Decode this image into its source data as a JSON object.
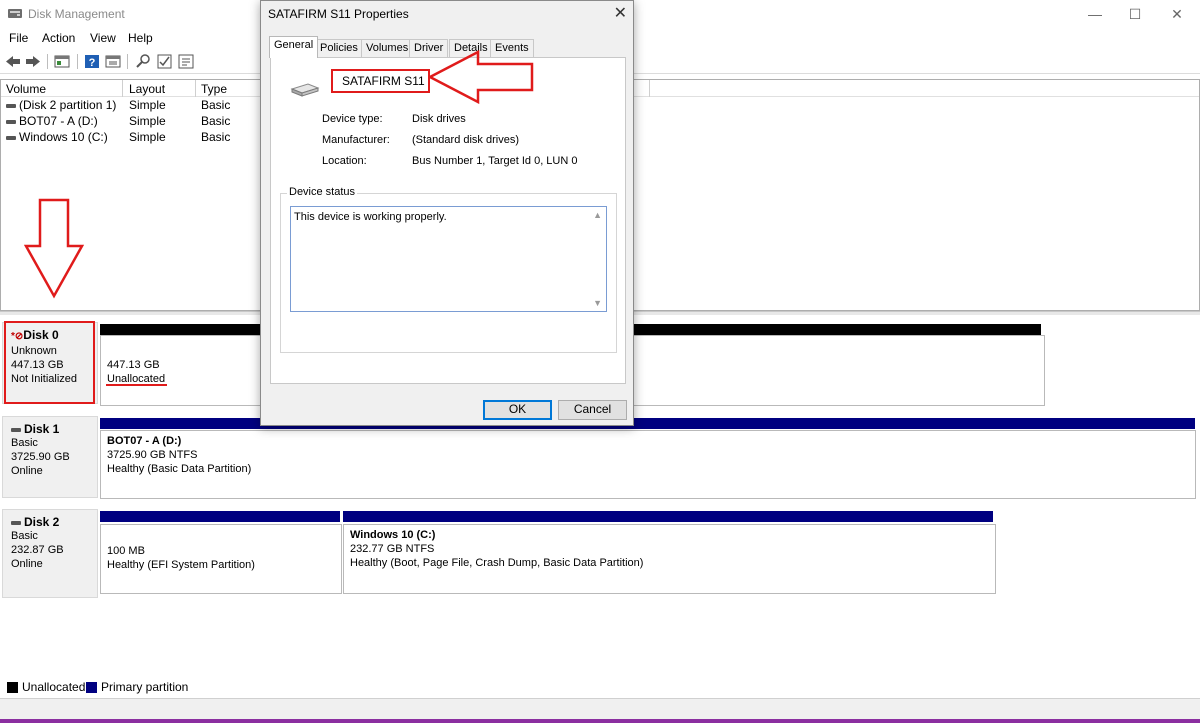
{
  "window": {
    "title": "Disk Management"
  },
  "menu": [
    "File",
    "Action",
    "View",
    "Help"
  ],
  "toolbar_icons": [
    "back-arrow-icon",
    "forward-arrow-icon",
    "console-tree-icon",
    "help-icon",
    "properties-sheet-icon",
    "connect-icon",
    "check-icon",
    "settings-list-icon"
  ],
  "volume_list": {
    "headers": [
      "Volume",
      "Layout",
      "Type"
    ],
    "rows": [
      {
        "volume": "(Disk 2 partition 1)",
        "layout": "Simple",
        "type": "Basic"
      },
      {
        "volume": "BOT07 - A (D:)",
        "layout": "Simple",
        "type": "Basic"
      },
      {
        "volume": "Windows 10 (C:)",
        "layout": "Simple",
        "type": "Basic"
      }
    ]
  },
  "disks": [
    {
      "name": "Disk 0",
      "kind": "Unknown",
      "size": "447.13 GB",
      "state": "Not Initialized",
      "partitions": [
        {
          "size": "447.13 GB",
          "status": "Unallocated"
        }
      ]
    },
    {
      "name": "Disk 1",
      "kind": "Basic",
      "size": "3725.90 GB",
      "state": "Online",
      "partitions": [
        {
          "title": "BOT07 - A  (D:)",
          "size": "3725.90 GB NTFS",
          "status": "Healthy (Basic Data Partition)"
        }
      ]
    },
    {
      "name": "Disk 2",
      "kind": "Basic",
      "size": "232.87 GB",
      "state": "Online",
      "partitions": [
        {
          "size": "100 MB",
          "status": "Healthy (EFI System Partition)"
        },
        {
          "title": "Windows 10  (C:)",
          "size": "232.77 GB NTFS",
          "status": "Healthy (Boot, Page File, Crash Dump, Basic Data Partition)"
        }
      ]
    }
  ],
  "legend": [
    {
      "label": "Unallocated",
      "color": "#000000"
    },
    {
      "label": "Primary partition",
      "color": "#000080"
    }
  ],
  "dialog": {
    "title": "SATAFIRM   S11 Properties",
    "tabs": [
      "General",
      "Policies",
      "Volumes",
      "Driver",
      "Details",
      "Events"
    ],
    "active_tab": "General",
    "device_name": "SATAFIRM   S11",
    "properties": [
      {
        "label": "Device type:",
        "value": "Disk drives"
      },
      {
        "label": "Manufacturer:",
        "value": "(Standard disk drives)"
      },
      {
        "label": "Location:",
        "value": "Bus Number 1, Target Id 0, LUN 0"
      }
    ],
    "status_label": "Device status",
    "status_text": "This device is working properly.",
    "ok_label": "OK",
    "cancel_label": "Cancel"
  },
  "colors": {
    "annotation": "#e01b1b",
    "primary_partition": "#000080",
    "unallocated": "#000000"
  }
}
